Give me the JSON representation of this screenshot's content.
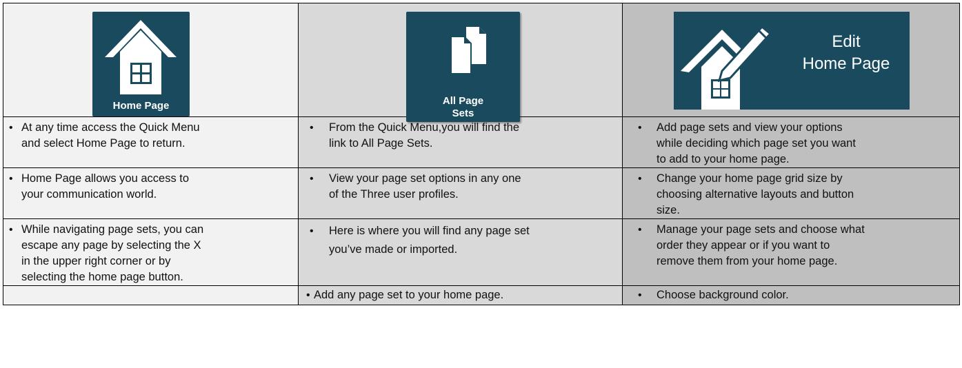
{
  "tiles": [
    {
      "label": "Home Page",
      "icon": "house-icon"
    },
    {
      "label_line1": "All Page",
      "label_line2": "Sets",
      "icon": "documents-icon"
    },
    {
      "label_line1": "Edit",
      "label_line2": "Home Page",
      "icon": "house-pencil-icon"
    }
  ],
  "colors": {
    "tile": "#1a4a5e",
    "col1": "#f2f2f2",
    "col2": "#d9d9d9",
    "col3": "#bfbfbf"
  },
  "rows": [
    {
      "col1": [
        "At any time access the Quick Menu",
        "and select Home Page to return."
      ],
      "col2": [
        "From the Quick Menu,you will find the",
        "link to All Page Sets."
      ],
      "col3": [
        "Add page sets and view your options",
        "while deciding which page set you want",
        "to add to your home page."
      ]
    },
    {
      "col1": [
        "Home Page allows you access to",
        "your communication world."
      ],
      "col2": [
        "View your page set options in any one",
        "of the Three user profiles."
      ],
      "col3": [
        "Change your home page grid size by",
        "choosing alternative layouts and button",
        "size."
      ]
    },
    {
      "col1": [
        "While navigating page sets, you can",
        "escape any page by selecting the X",
        "in the upper right corner or by",
        "selecting the home page button."
      ],
      "col2": [
        "Here is where you will find any page set",
        "you’ve made or imported."
      ],
      "col3": [
        "Manage your page sets and choose what",
        "order they appear or if you want to",
        "remove them from your home page."
      ]
    },
    {
      "col1": [],
      "col2": [
        "Add any page set to your home page."
      ],
      "col3": [
        "Choose background color."
      ]
    }
  ]
}
